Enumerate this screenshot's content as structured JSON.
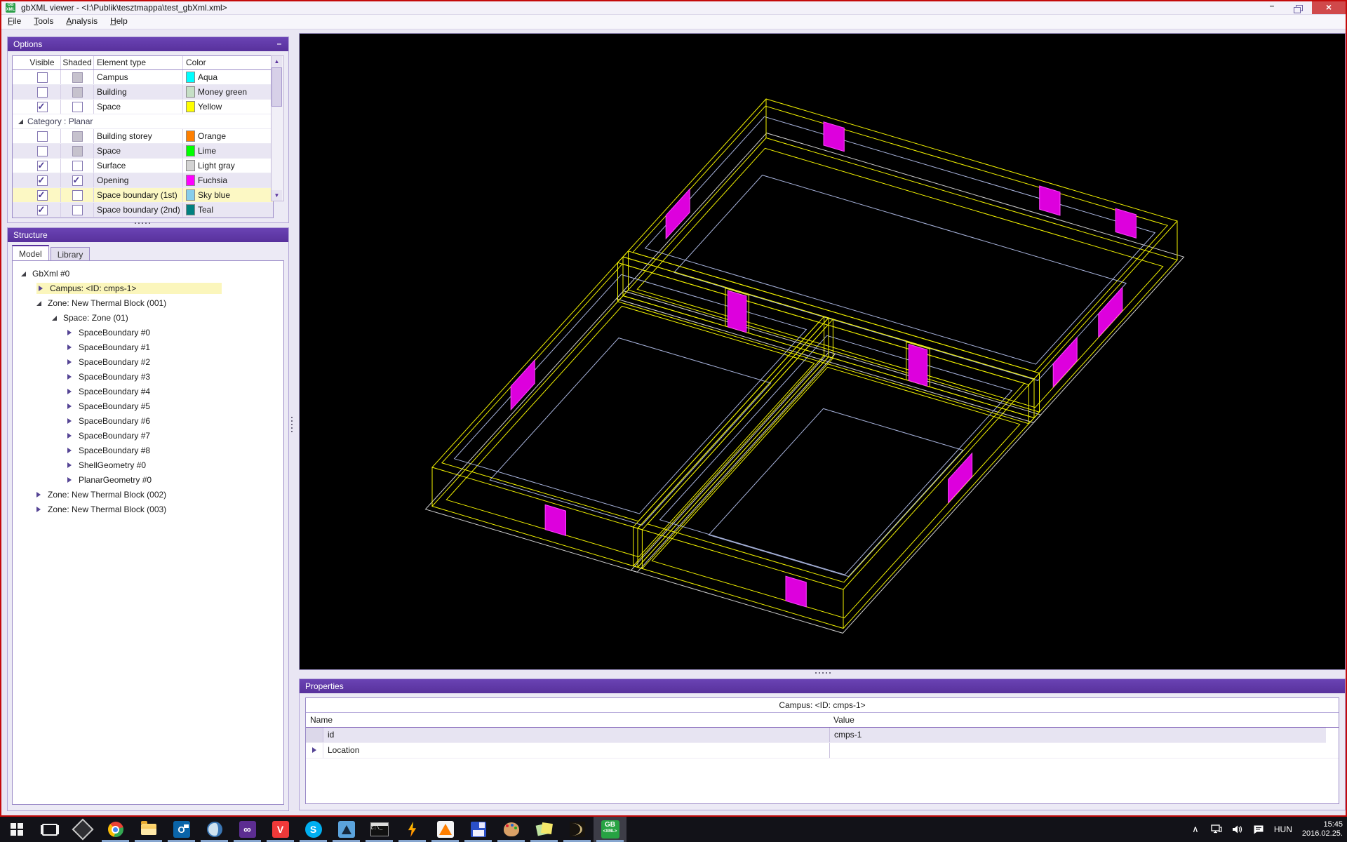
{
  "window": {
    "title": "gbXML viewer - <I:\\Publik\\tesztmappa\\test_gbXml.xml>",
    "icon_label": "GB XML",
    "minimize_label": "–",
    "close_label": "×"
  },
  "menu": {
    "items": [
      "File",
      "Tools",
      "Analysis",
      "Help"
    ]
  },
  "options_panel": {
    "title": "Options",
    "collapse_label": "–",
    "columns": [
      "Visible",
      "Shaded",
      "Element type",
      "Color"
    ],
    "rows": [
      {
        "element": "Campus",
        "visible": false,
        "shaded": "disabled",
        "color_name": "Aqua",
        "color": "#00FFFF"
      },
      {
        "element": "Building",
        "visible": false,
        "shaded": "disabled",
        "color_name": "Money green",
        "color": "#C6DFC6"
      },
      {
        "element": "Space",
        "visible": true,
        "shaded": false,
        "color_name": "Yellow",
        "color": "#FFFF00"
      },
      {
        "group": true,
        "label": "Category : Planar"
      },
      {
        "element": "Building storey",
        "visible": false,
        "shaded": "disabled",
        "color_name": "Orange",
        "color": "#FF8000"
      },
      {
        "element": "Space",
        "visible": false,
        "shaded": "disabled",
        "color_name": "Lime",
        "color": "#00FF00"
      },
      {
        "element": "Surface",
        "visible": true,
        "shaded": false,
        "color_name": "Light gray",
        "color": "#D3D3D3"
      },
      {
        "element": "Opening",
        "visible": true,
        "shaded": true,
        "color_name": "Fuchsia",
        "color": "#FF00FF"
      },
      {
        "element": "Space boundary (1st)",
        "visible": true,
        "shaded": false,
        "color_name": "Sky blue",
        "color": "#87CEEB",
        "selected": true
      },
      {
        "element": "Space boundary (2nd)",
        "visible": true,
        "shaded": false,
        "color_name": "Teal",
        "color": "#008080"
      }
    ]
  },
  "structure_panel": {
    "title": "Structure",
    "tabs": [
      {
        "label": "Model",
        "active": true
      },
      {
        "label": "Library",
        "active": false
      }
    ],
    "tree": [
      {
        "label": "GbXml #0",
        "depth": 0,
        "state": "expanded"
      },
      {
        "label": "Campus: <ID: cmps-1>",
        "depth": 1,
        "state": "collapsed",
        "selected": true
      },
      {
        "label": "Zone: New Thermal Block (001)",
        "depth": 1,
        "state": "expanded"
      },
      {
        "label": "Space: Zone (01)",
        "depth": 2,
        "state": "expanded"
      },
      {
        "label": "SpaceBoundary #0",
        "depth": 3,
        "state": "collapsed"
      },
      {
        "label": "SpaceBoundary #1",
        "depth": 3,
        "state": "collapsed"
      },
      {
        "label": "SpaceBoundary #2",
        "depth": 3,
        "state": "collapsed"
      },
      {
        "label": "SpaceBoundary #3",
        "depth": 3,
        "state": "collapsed"
      },
      {
        "label": "SpaceBoundary #4",
        "depth": 3,
        "state": "collapsed"
      },
      {
        "label": "SpaceBoundary #5",
        "depth": 3,
        "state": "collapsed"
      },
      {
        "label": "SpaceBoundary #6",
        "depth": 3,
        "state": "collapsed"
      },
      {
        "label": "SpaceBoundary #7",
        "depth": 3,
        "state": "collapsed"
      },
      {
        "label": "SpaceBoundary #8",
        "depth": 3,
        "state": "collapsed"
      },
      {
        "label": "ShellGeometry #0",
        "depth": 3,
        "state": "collapsed"
      },
      {
        "label": "PlanarGeometry #0",
        "depth": 3,
        "state": "collapsed"
      },
      {
        "label": "Zone: New Thermal Block (002)",
        "depth": 1,
        "state": "collapsed"
      },
      {
        "label": "Zone: New Thermal Block (003)",
        "depth": 1,
        "state": "collapsed"
      }
    ]
  },
  "properties_panel": {
    "title": "Properties",
    "object_title": "Campus: <ID: cmps-1>",
    "name_col": "Name",
    "value_col": "Value",
    "rows": [
      {
        "name": "id",
        "value": "cmps-1",
        "selected": true,
        "expandable": false
      },
      {
        "name": "Location",
        "value": "",
        "selected": false,
        "expandable": true
      }
    ]
  },
  "viewport": {
    "scene": {
      "origin": [
        665,
        93
      ],
      "u": [
        29.3,
        8.7
      ],
      "v": [
        -34.0,
        37.5
      ],
      "zscale": 18.5,
      "wall_height": 3,
      "colors": {
        "space": "#f2f200",
        "boundary": "#a9b5de",
        "surface": "#cfcfcf",
        "opening_fill": "#dd00dd",
        "opening_edge": "#ff44ff",
        "frame": "#f2f200"
      },
      "zones": [
        {
          "u0": 0,
          "v0": 0,
          "u1": 20,
          "v1": 6,
          "rim": 0.22,
          "floor": 0.32,
          "btop": 0.5,
          "bfloor": 1.15
        },
        {
          "u0": 0,
          "v0": 6,
          "u1": 10,
          "v1": 14,
          "rim": 0.22,
          "floor": 0.32,
          "btop": 0.5,
          "bfloor": 1.3
        },
        {
          "u0": 10,
          "v0": 6,
          "u1": 20,
          "v1": 14,
          "rim": 0.22,
          "floor": 0.32,
          "btop": 0.5,
          "bfloor": 1.6
        }
      ],
      "walls": [
        {
          "axis": "v",
          "at": 6,
          "f": 0,
          "t": 20,
          "th": 0.22
        },
        {
          "axis": "u",
          "at": 10,
          "f": 6,
          "t": 14,
          "th": 0.22
        }
      ],
      "openings": [
        {
          "a": [
            2.8,
            0
          ],
          "b": [
            3.8,
            0
          ],
          "ztop": 2.55,
          "h": 1.8,
          "door": false
        },
        {
          "a": [
            13.3,
            0
          ],
          "b": [
            14.3,
            0
          ],
          "ztop": 2.55,
          "h": 1.8,
          "door": false
        },
        {
          "a": [
            17.0,
            0
          ],
          "b": [
            18.0,
            0
          ],
          "ztop": 2.55,
          "h": 1.8,
          "door": false
        },
        {
          "a": [
            0,
            3.2
          ],
          "b": [
            0,
            4.2
          ],
          "ztop": 2.55,
          "h": 1.8,
          "door": false
        },
        {
          "a": [
            0,
            9.7
          ],
          "b": [
            0,
            10.7
          ],
          "ztop": 2.55,
          "h": 1.8,
          "door": false
        },
        {
          "a": [
            20,
            2.3
          ],
          "b": [
            20,
            3.3
          ],
          "ztop": 2.55,
          "h": 1.8,
          "door": false
        },
        {
          "a": [
            20,
            4.2
          ],
          "b": [
            20,
            5.2
          ],
          "ztop": 2.55,
          "h": 1.8,
          "door": false
        },
        {
          "a": [
            20,
            8.6
          ],
          "b": [
            20,
            9.6
          ],
          "ztop": 2.55,
          "h": 1.8,
          "door": false
        },
        {
          "a": [
            5.5,
            14
          ],
          "b": [
            6.5,
            14
          ],
          "ztop": 2.7,
          "h": 1.9,
          "door": false
        },
        {
          "a": [
            17.2,
            14
          ],
          "b": [
            18.2,
            14
          ],
          "ztop": 2.7,
          "h": 1.9,
          "door": false
        },
        {
          "a": [
            5.1,
            6
          ],
          "b": [
            6.0,
            6
          ],
          "ztop": 2.8,
          "h": 2.8,
          "door": true
        },
        {
          "a": [
            13.9,
            6
          ],
          "b": [
            14.8,
            6
          ],
          "ztop": 2.8,
          "h": 2.8,
          "door": true
        }
      ]
    }
  },
  "taskbar": {
    "apps": [
      {
        "name": "start",
        "running": false,
        "active": false
      },
      {
        "name": "task-view",
        "running": false,
        "active": false
      },
      {
        "name": "unity",
        "running": false,
        "active": false
      },
      {
        "name": "chrome",
        "running": true,
        "active": false
      },
      {
        "name": "file-explorer",
        "running": true,
        "active": false
      },
      {
        "name": "outlook",
        "running": true,
        "active": false
      },
      {
        "name": "globe-app",
        "running": true,
        "active": false
      },
      {
        "name": "visual-studio",
        "running": true,
        "active": false
      },
      {
        "name": "vivaldi",
        "running": true,
        "active": false
      },
      {
        "name": "skype",
        "running": true,
        "active": false
      },
      {
        "name": "blue-bird-app",
        "running": true,
        "active": false
      },
      {
        "name": "command-prompt",
        "running": true,
        "active": false
      },
      {
        "name": "winamp",
        "running": true,
        "active": false
      },
      {
        "name": "vlc",
        "running": true,
        "active": false
      },
      {
        "name": "total-commander",
        "running": true,
        "active": false
      },
      {
        "name": "paint-palette",
        "running": true,
        "active": false
      },
      {
        "name": "sticky-notes",
        "running": true,
        "active": false
      },
      {
        "name": "dark-cad-app",
        "running": true,
        "active": false
      },
      {
        "name": "gbxml-viewer",
        "running": true,
        "active": true,
        "label": "GB",
        "sub": "<XML>"
      }
    ],
    "tray": {
      "language": "HUN",
      "time": "15:45",
      "date": "2016.02.25."
    }
  }
}
